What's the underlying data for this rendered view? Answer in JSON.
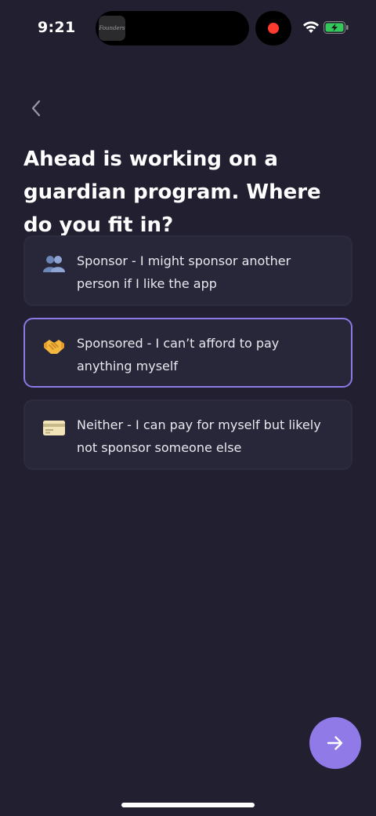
{
  "status_bar": {
    "time": "9:21",
    "island_app_label": "Founders"
  },
  "header": {
    "back_icon": "chevron-left-icon"
  },
  "question": {
    "title": "Ahead is working on a guardian program. Where do you fit in?"
  },
  "options": [
    {
      "icon": "two-people-icon",
      "label": "Sponsor - I might sponsor another person if I like the app",
      "selected": false
    },
    {
      "icon": "handshake-icon",
      "label": "Sponsored - I can’t afford to pay anything myself",
      "selected": true
    },
    {
      "icon": "credit-card-icon",
      "label": "Neither - I can pay for myself but likely not sponsor someone else",
      "selected": false
    }
  ],
  "next_button": {
    "icon": "arrow-right-icon"
  },
  "colors": {
    "background": "#211f30",
    "card": "#282739",
    "accent": "#8f7ae8",
    "selected_border": "#8b79e6"
  }
}
